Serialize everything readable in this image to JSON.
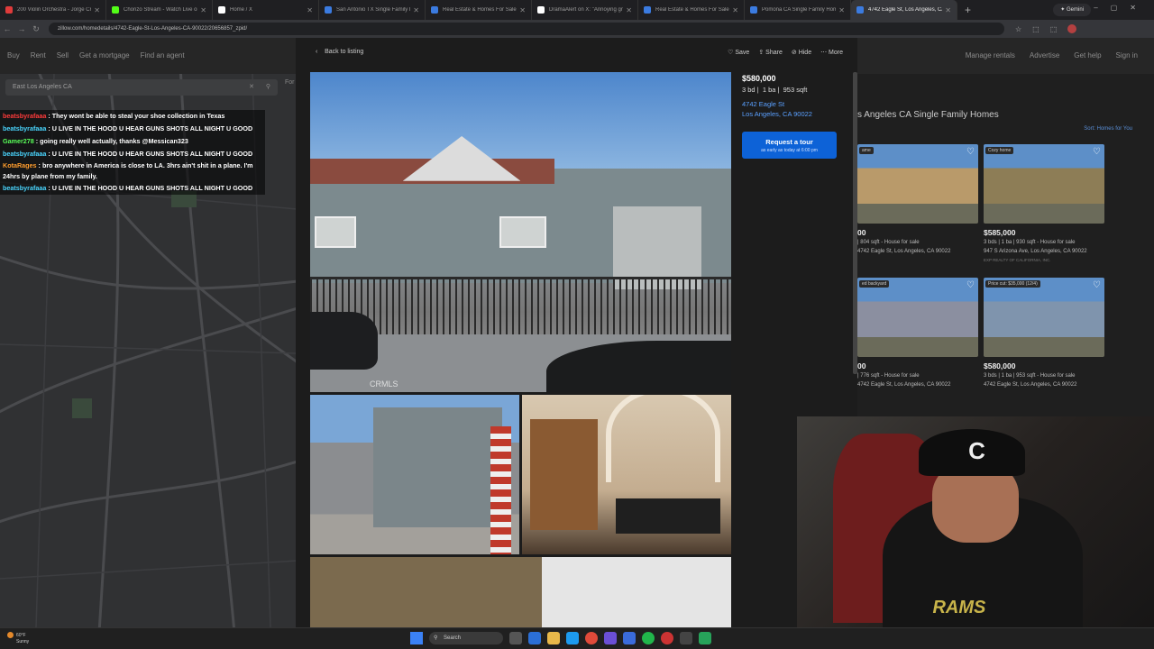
{
  "browser": {
    "tabs": [
      {
        "title": "200 Violin Orchestra - Jorge Cr",
        "color": "#e03b3b"
      },
      {
        "title": "Chorizo Stream - Watch Live on",
        "color": "#53fc18"
      },
      {
        "title": "Home / X",
        "color": "#ffffff"
      },
      {
        "title": "San Antonio TX Single Family H",
        "color": "#3b7be0"
      },
      {
        "title": "Real Estate & Homes For Sale",
        "color": "#3b7be0"
      },
      {
        "title": "DramaAlert on X: \"Annoying gr",
        "color": "#ffffff"
      },
      {
        "title": "Real Estate & Homes For Sale",
        "color": "#3b7be0"
      },
      {
        "title": "Pomona CA Single Family Hom",
        "color": "#3b7be0"
      },
      {
        "title": "4742 Eagle St, Los Angeles, CA",
        "color": "#3b7be0"
      }
    ],
    "new_tab": "+",
    "gemini_label": "✦ Gemini",
    "url": "zillow.com/homedetails/4742-Eagle-St-Los-Angeles-CA-90022/20656857_zpid/"
  },
  "site_nav": {
    "left": [
      "Buy",
      "Rent",
      "Sell",
      "Get a mortgage",
      "Find an agent"
    ],
    "right": [
      "Manage rentals",
      "Advertise",
      "Get help",
      "Sign in"
    ]
  },
  "search": {
    "value": "East Los Angeles CA",
    "filter_label": "For"
  },
  "chat": [
    {
      "user": "beatsbyrafaaa",
      "color": "#ff3b3b",
      "text": "They wont be able to steal your shoe collection in Texas"
    },
    {
      "user": "beatsbyrafaaa",
      "color": "#4ad6ff",
      "text": "U LIVE IN THE HOOD U HEAR GUNS SHOTS ALL NIGHT U GOOD"
    },
    {
      "user": "Gamer278",
      "color": "#59ff59",
      "text": "going really well actually, thanks @Messican323"
    },
    {
      "user": "beatsbyrafaaa",
      "color": "#4ad6ff",
      "text": "U LIVE IN THE HOOD U HEAR GUNS SHOTS ALL NIGHT U GOOD"
    },
    {
      "user": "KotaRages",
      "color": "#ff9d2e",
      "text": "bro anywhere in America is close to LA. 3hrs ain't shit in a plane. I'm 24hrs by plane from my family."
    },
    {
      "user": "beatsbyrafaaa",
      "color": "#4ad6ff",
      "text": "U LIVE IN THE HOOD U HEAR GUNS SHOTS ALL NIGHT U GOOD"
    }
  ],
  "listing": {
    "back_label": "Back to listing",
    "actions": [
      "Save",
      "Share",
      "Hide",
      "More"
    ],
    "watermark": "CRMLS",
    "price": "$580,000",
    "beds": "3 bd",
    "baths": "1 ba",
    "sqft": "953 sqft",
    "address_line1": "4742 Eagle St",
    "address_line2": "Los Angeles, CA 90022",
    "tour_button": "Request a tour",
    "tour_sub": "as early as today at 6:00 pm"
  },
  "results": {
    "title": "s Angeles CA Single Family Homes",
    "sort": "Sort: Homes for You",
    "cards": [
      {
        "label": "ame",
        "price": "00",
        "details": "| 804 sqft - House for sale",
        "address": "4742 Eagle St, Los Angeles, CA 90022",
        "broker": "",
        "bg": "#b99a6a"
      },
      {
        "label": "Cozy home",
        "price": "$585,000",
        "details": "3 bds | 1 ba | 930 sqft - House for sale",
        "address": "947 S Arizona Ave, Los Angeles, CA 90022",
        "broker": "EXP REALTY OF CALIFORNIA, INC.",
        "bg": "#8d7d56"
      },
      {
        "label": "ed backyard",
        "price": "00",
        "details": "| 776 sqft - House for sale",
        "address": "4742 Eagle St, Los Angeles, CA 90022",
        "broker": "",
        "bg": "#8b8fa0"
      },
      {
        "label": "Price cut: $35,000 (12/4)",
        "price": "$580,000",
        "details": "3 bds | 1 ba | 953 sqft - House for sale",
        "address": "4742 Eagle St, Los Angeles, CA 90022",
        "broker": "",
        "bg": "#7f94ad"
      }
    ]
  },
  "webcam": {
    "cap_letter": "C",
    "shirt_text": "RAMS"
  },
  "taskbar": {
    "temp": "60°F",
    "condition": "Sunny",
    "search_placeholder": "Search"
  }
}
